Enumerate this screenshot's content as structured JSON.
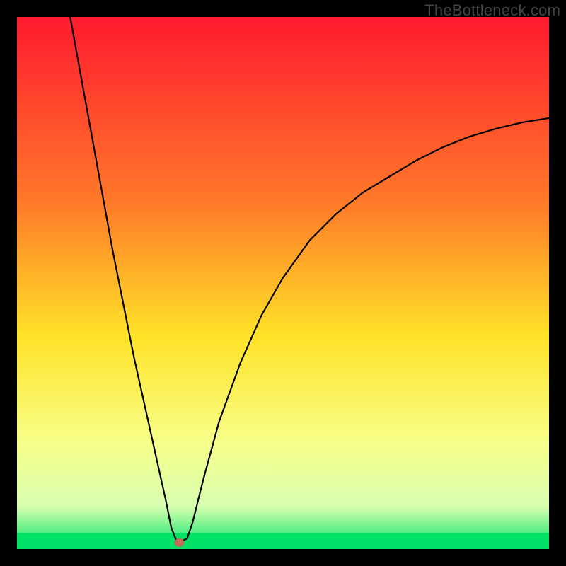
{
  "watermark": "TheBottleneck.com",
  "colors": {
    "frame": "#000000",
    "gradient_top": "#ff1a2f",
    "gradient_mid1": "#ff7a29",
    "gradient_mid2": "#ffe327",
    "gradient_mid3": "#f7ff8a",
    "gradient_bottom_band": "#d8ffb0",
    "gradient_bottom": "#00e266",
    "curve": "#000000",
    "marker": "#c56a5a"
  },
  "chart_data": {
    "type": "line",
    "title": "",
    "xlabel": "",
    "ylabel": "",
    "xlim": [
      0,
      100
    ],
    "ylim": [
      0,
      100
    ],
    "grid": false,
    "legend": "none",
    "annotations": [
      {
        "text": "TheBottleneck.com",
        "pos": "top-right"
      }
    ],
    "series": [
      {
        "name": "bottleneck-curve",
        "x": [
          10,
          12,
          14,
          16,
          18,
          20,
          22,
          24,
          26,
          28,
          29,
          30,
          31,
          32,
          33,
          35,
          38,
          42,
          46,
          50,
          55,
          60,
          65,
          70,
          75,
          80,
          85,
          90,
          95,
          100
        ],
        "y": [
          100,
          89,
          78,
          67,
          56,
          46,
          36,
          27,
          18,
          9,
          4,
          1.5,
          1.5,
          2,
          5,
          13,
          24,
          35,
          44,
          51,
          58,
          63,
          67,
          70,
          73,
          75.5,
          77.5,
          79,
          80.2,
          81
        ]
      }
    ],
    "minimum_marker": {
      "x": 30.5,
      "y": 1.2
    },
    "background_gradient": {
      "direction": "vertical",
      "stops": [
        {
          "pos": 0.0,
          "color": "#ff1a2f"
        },
        {
          "pos": 0.35,
          "color": "#ff7a29"
        },
        {
          "pos": 0.6,
          "color": "#ffe327"
        },
        {
          "pos": 0.8,
          "color": "#f7ff8a"
        },
        {
          "pos": 0.92,
          "color": "#d8ffb0"
        },
        {
          "pos": 1.0,
          "color": "#00e266"
        }
      ]
    },
    "bottom_green_band_fraction": 0.03
  }
}
